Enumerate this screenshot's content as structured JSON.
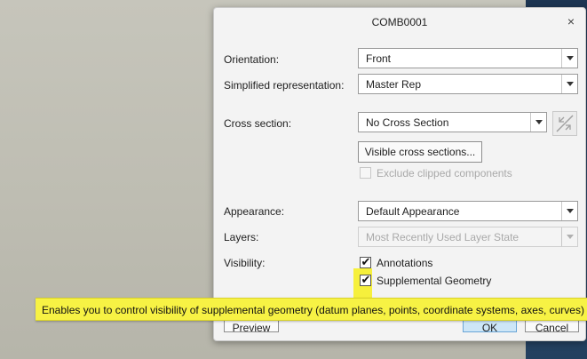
{
  "dialog": {
    "title": "COMB0001",
    "close_glyph": "×"
  },
  "fields": {
    "orientation": {
      "label": "Orientation:",
      "value": "Front"
    },
    "simplified_rep": {
      "label": "Simplified representation:",
      "value": "Master Rep"
    },
    "cross_section": {
      "label": "Cross section:",
      "value": "No Cross Section",
      "icon": "cross-section-direction-icon"
    },
    "visible_cross_sections_button": "Visible cross sections...",
    "exclude_clipped": {
      "label": "Exclude clipped components",
      "checked": false,
      "enabled": false
    },
    "appearance": {
      "label": "Appearance:",
      "value": "Default Appearance"
    },
    "layers": {
      "label": "Layers:",
      "value": "Most Recently Used Layer State",
      "enabled": false
    },
    "visibility": {
      "label": "Visibility:",
      "annotations": {
        "label": "Annotations",
        "checked": true
      },
      "supplemental_geometry": {
        "label": "Supplemental Geometry",
        "checked": true
      }
    }
  },
  "buttons": {
    "preview": "Preview",
    "ok": "OK",
    "cancel": "Cancel"
  },
  "tooltip": {
    "text": "Enables you to control visibility of supplemental geometry (datum planes, points, coordinate systems, axes, curves)"
  },
  "colors": {
    "highlight": "#f6f03c",
    "ok_button": "#cde6f7",
    "background_right": "#1d3552"
  }
}
